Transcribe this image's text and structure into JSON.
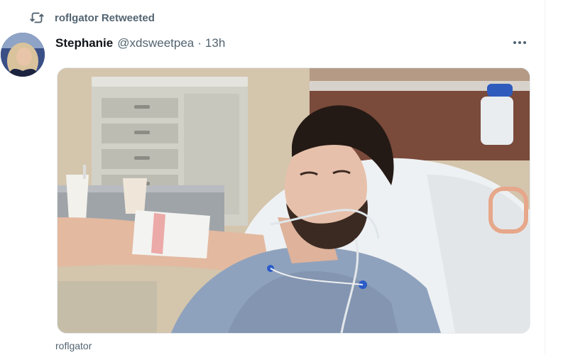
{
  "retweet": {
    "icon": "retweet-icon",
    "text": "roflgator Retweeted"
  },
  "tweet": {
    "author_name": "Stephanie",
    "handle": "@xdsweetpea",
    "separator": "·",
    "time": "13h",
    "avatar_icon": "avatar",
    "more_icon": "more-dots-icon"
  },
  "next_tweet": {
    "author_name": "roflgator"
  },
  "colors": {
    "secondary_text": "#536471",
    "primary_text": "#0f1419",
    "divider": "#eff3f4"
  }
}
